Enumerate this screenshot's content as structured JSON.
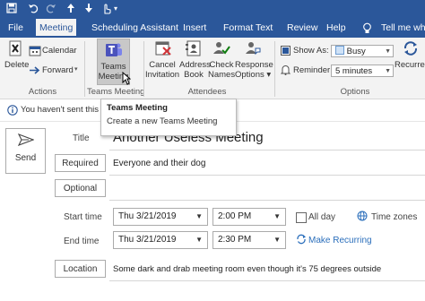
{
  "colors": {
    "ribbon_blue": "#2b579a",
    "ribbon_bg": "#f3f3f3",
    "busy_swatch": "#cfe2f7",
    "link_blue": "#2a6ebb"
  },
  "titlebar": {
    "icons": [
      "save-icon",
      "undo-icon",
      "redo-icon",
      "up-arrow-icon",
      "down-arrow-icon",
      "touch-mode-icon"
    ]
  },
  "tabs": [
    "File",
    "Meeting",
    "Scheduling Assistant",
    "Insert",
    "Format Text",
    "Review",
    "Help"
  ],
  "tell_me": "Tell me wh",
  "ribbon": {
    "delete": "Delete",
    "calendar": "Calendar",
    "forward": "Forward",
    "actions_group": "Actions",
    "teams_l1": "Teams",
    "teams_l2": "Meeting",
    "teams_group": "Teams Meeting",
    "cancel_l1": "Cancel",
    "cancel_l2": "Invitation",
    "address_l1": "Address",
    "address_l2": "Book",
    "check_l1": "Check",
    "check_l2": "Names",
    "response_l1": "Response",
    "response_l2": "Options",
    "attendees_group": "Attendees",
    "show_as_label": "Show As:",
    "show_as_value": "Busy",
    "reminder_label": "Reminder:",
    "reminder_value": "5 minutes",
    "recurrence": "Recurrence",
    "options_group": "Options"
  },
  "info_bar": "You haven't sent this me",
  "tooltip": {
    "title": "Teams Meeting",
    "desc": "Create a new Teams Meeting"
  },
  "form": {
    "send": "Send",
    "title_label": "Title",
    "title_value": "Another Useless Meeting",
    "required_label": "Required",
    "required_value": "Everyone and their dog",
    "optional_label": "Optional",
    "start_label": "Start time",
    "start_date": "Thu 3/21/2019",
    "start_time": "2:00 PM",
    "all_day": "All day",
    "time_zones": "Time zones",
    "end_label": "End time",
    "end_date": "Thu 3/21/2019",
    "end_time": "2:30 PM",
    "make_recurring": "Make Recurring",
    "location_label": "Location",
    "location_value": "Some dark and drab meeting room even though it's 75 degrees outside"
  }
}
